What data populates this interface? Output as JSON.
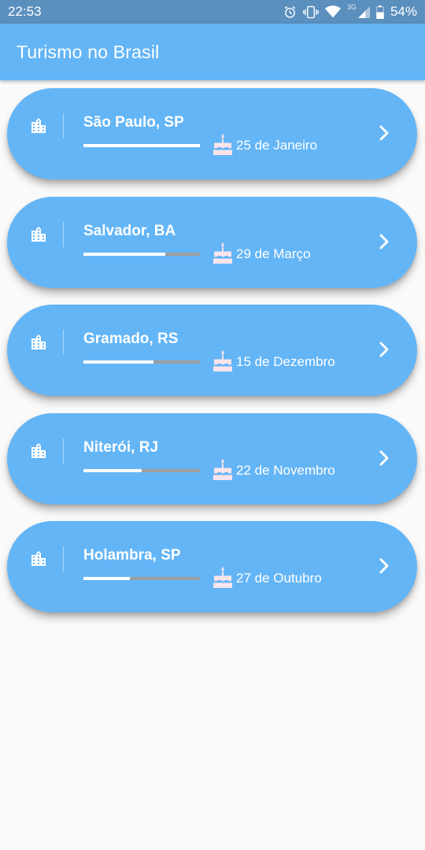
{
  "status_bar": {
    "time": "22:53",
    "network": "3G",
    "battery": "54%",
    "icons": [
      "alarm-icon",
      "vibrate-icon",
      "wifi-icon",
      "cell-signal-icon",
      "battery-icon"
    ]
  },
  "app_bar": {
    "title": "Turismo no Brasil"
  },
  "colors": {
    "status_bar": "#5a8fbe",
    "app_bar": "#64b5f6",
    "card": "#64b5f6",
    "progress_track": "#9e9e9e",
    "progress_fill": "#ffffff",
    "background": "#fafafa"
  },
  "cities": [
    {
      "name": "São Paulo, SP",
      "date": "25 de Janeiro",
      "progress": 1.0,
      "icon": "city-buildings-icon",
      "date_icon": "cake-icon",
      "action_icon": "chevron-right-icon"
    },
    {
      "name": "Salvador, BA",
      "date": "29 de Março",
      "progress": 0.7,
      "icon": "city-buildings-icon",
      "date_icon": "cake-icon",
      "action_icon": "chevron-right-icon"
    },
    {
      "name": "Gramado, RS",
      "date": "15 de Dezembro",
      "progress": 0.6,
      "icon": "city-buildings-icon",
      "date_icon": "cake-icon",
      "action_icon": "chevron-right-icon"
    },
    {
      "name": "Niterói, RJ",
      "date": "22 de Novembro",
      "progress": 0.5,
      "icon": "city-buildings-icon",
      "date_icon": "cake-icon",
      "action_icon": "chevron-right-icon"
    },
    {
      "name": "Holambra, SP",
      "date": "27 de Outubro",
      "progress": 0.4,
      "icon": "city-buildings-icon",
      "date_icon": "cake-icon",
      "action_icon": "chevron-right-icon"
    }
  ]
}
